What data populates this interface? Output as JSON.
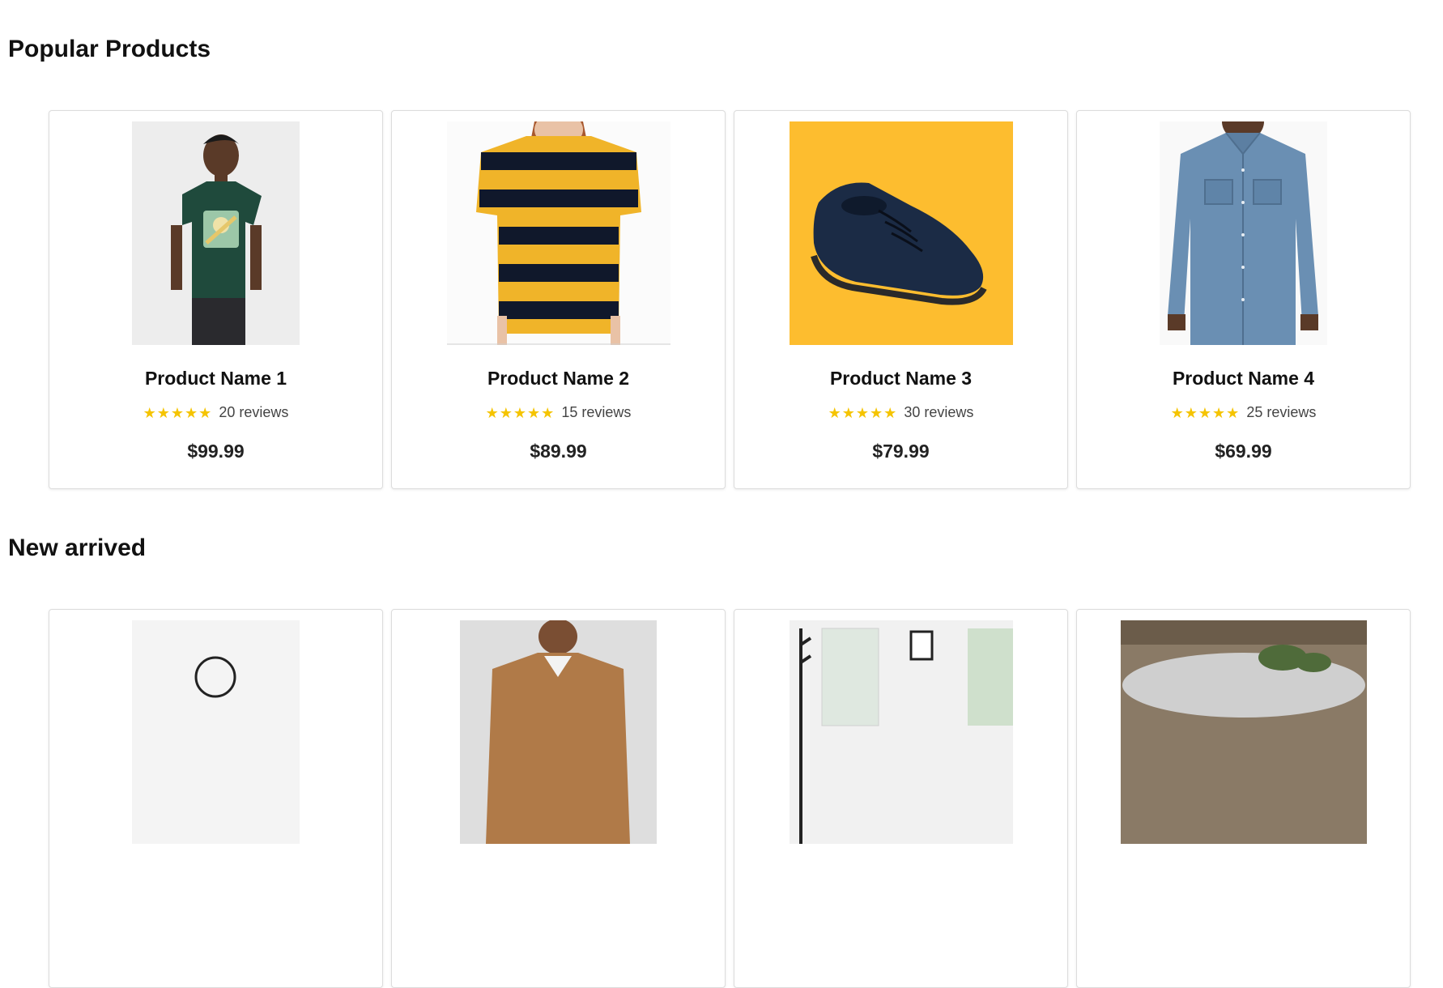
{
  "sections": {
    "popular": {
      "title": "Popular Products",
      "products": [
        {
          "name": "Product Name 1",
          "stars": "★★★★★",
          "rating": 5,
          "reviews": "20 reviews",
          "price": "$99.99",
          "image": "green-graphic-tshirt-photo"
        },
        {
          "name": "Product Name 2",
          "stars": "★★★★★",
          "rating": 5,
          "reviews": "15 reviews",
          "price": "$89.99",
          "image": "yellow-navy-striped-tshirt-photo"
        },
        {
          "name": "Product Name 3",
          "stars": "★★★★★",
          "rating": 5,
          "reviews": "30 reviews",
          "price": "$79.99",
          "image": "navy-sneaker-on-yellow-photo"
        },
        {
          "name": "Product Name 4",
          "stars": "★★★★★",
          "rating": 5,
          "reviews": "25 reviews",
          "price": "$69.99",
          "image": "denim-work-shirt-photo"
        }
      ]
    },
    "new_arrived": {
      "title": "New arrived",
      "products": [
        {
          "image": "product-photo-partial"
        },
        {
          "image": "tan-jacket-photo-partial"
        },
        {
          "image": "room-interior-photo-partial"
        },
        {
          "image": "plant-planter-photo-partial"
        }
      ]
    }
  },
  "colors": {
    "star": "#f5c400",
    "card_border": "#dcdcdc",
    "shoe_background": "#fdbd2f"
  }
}
